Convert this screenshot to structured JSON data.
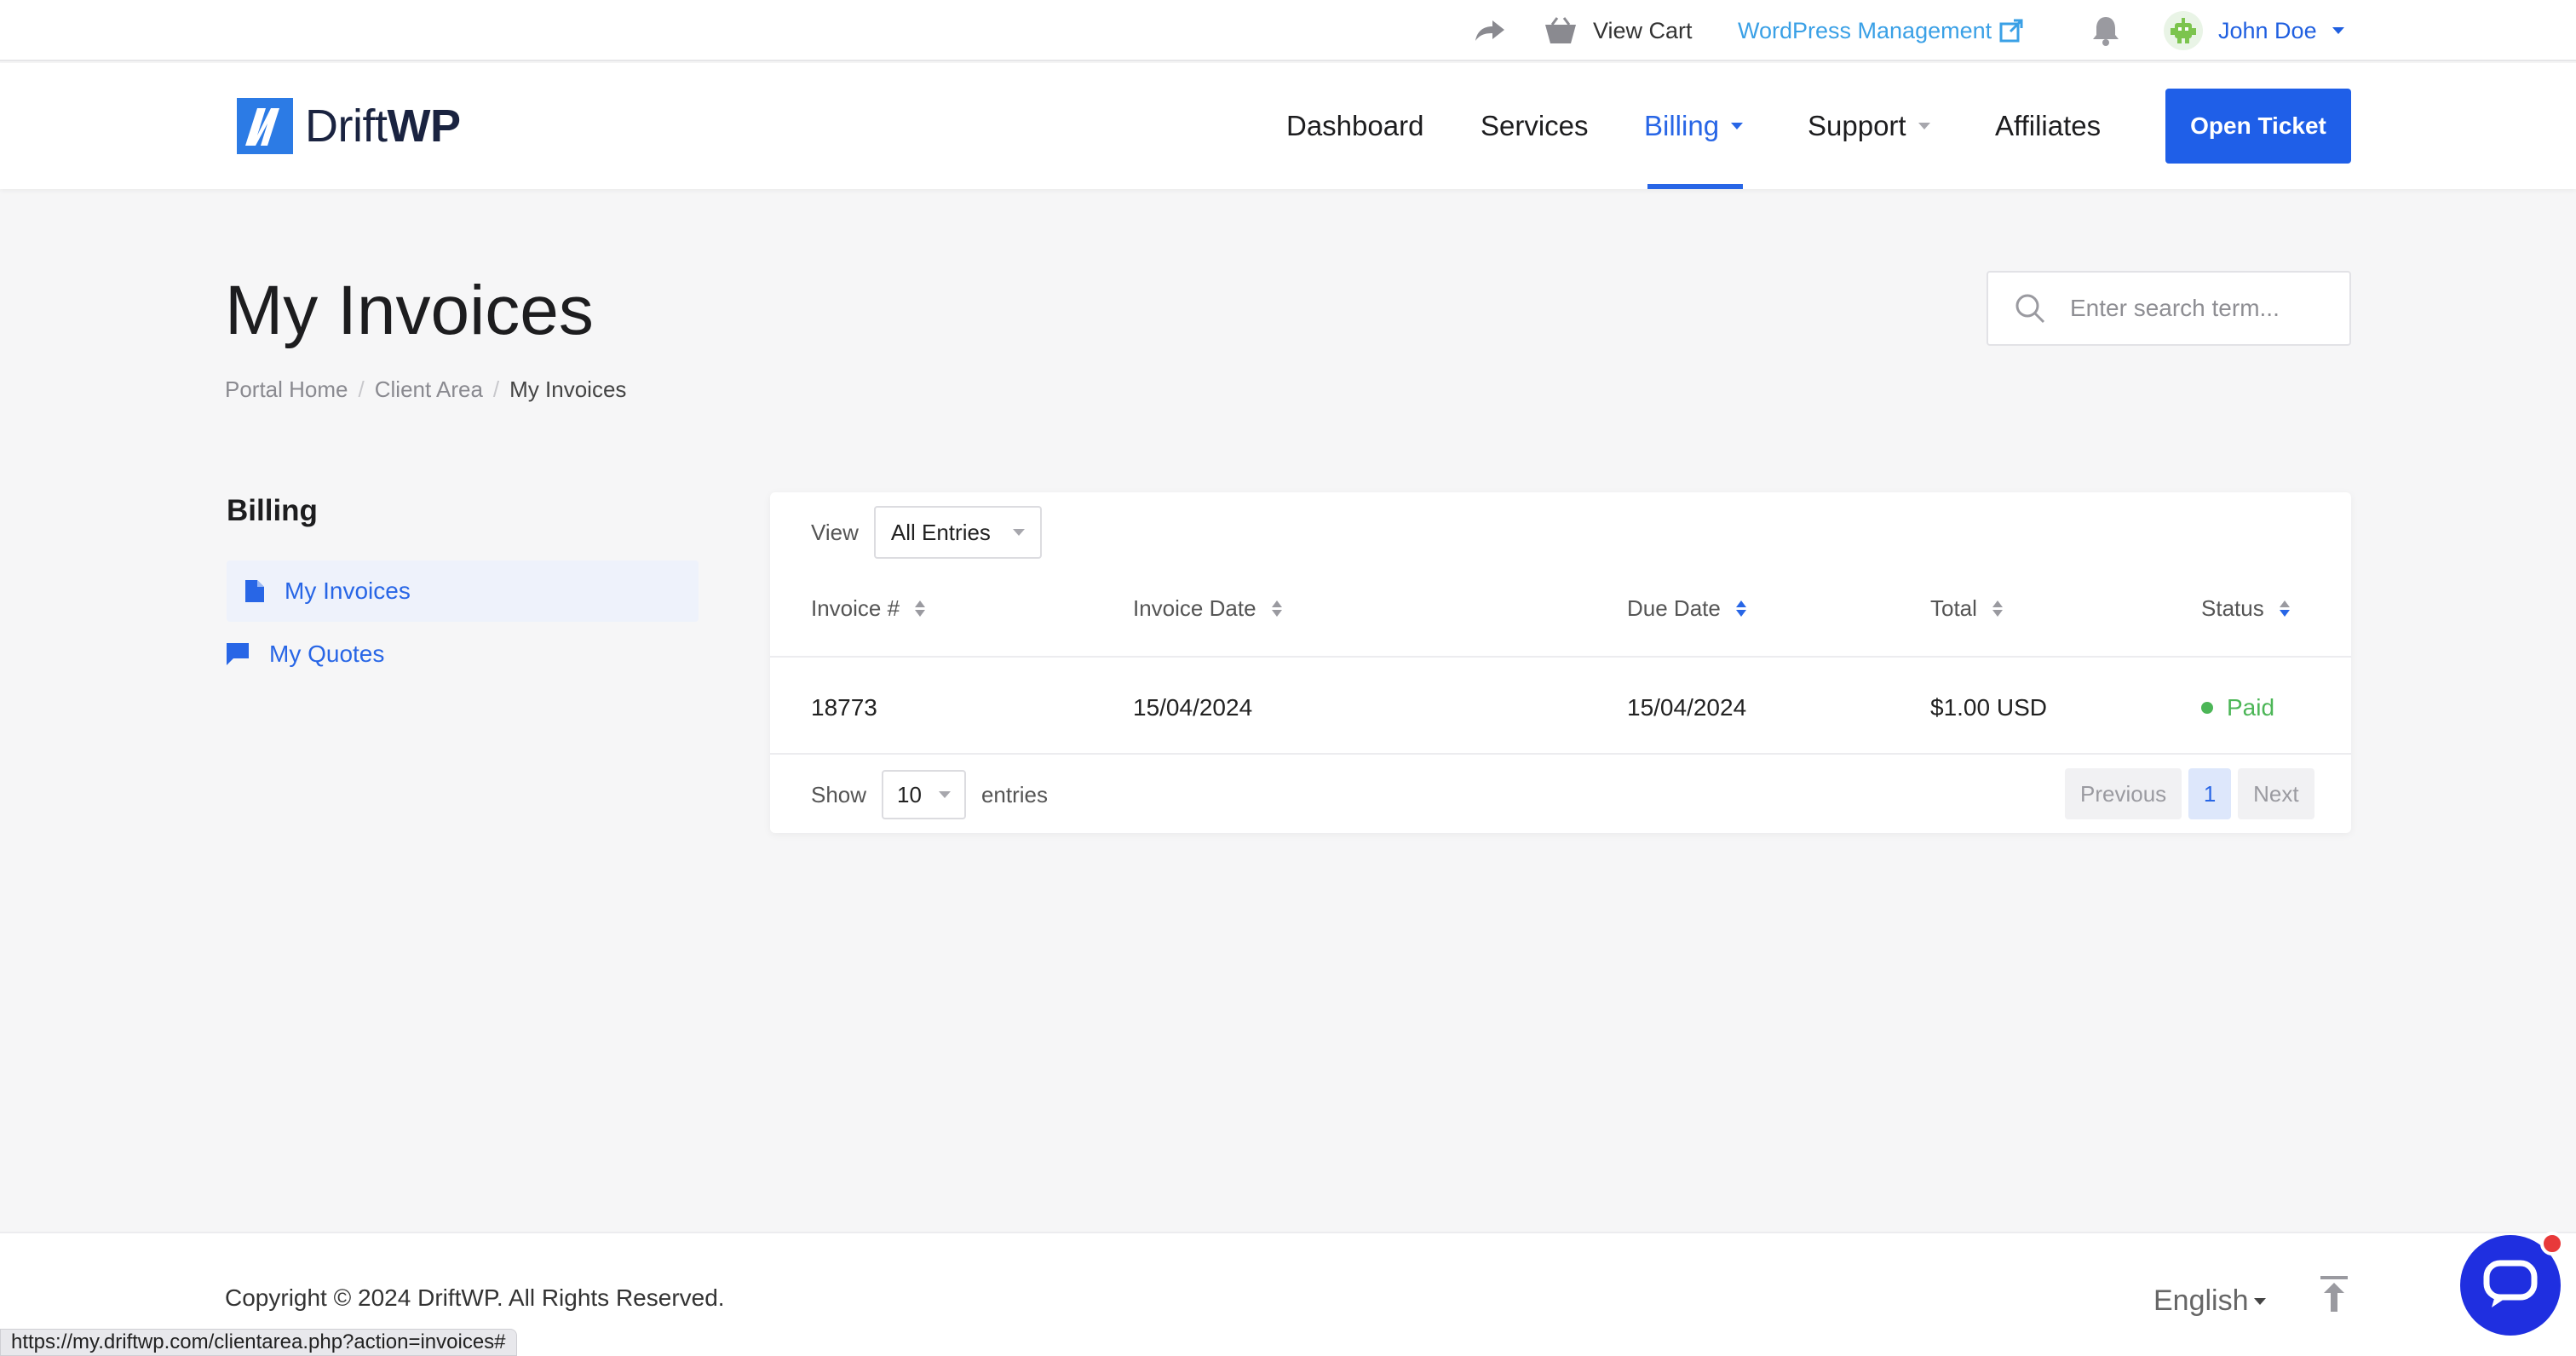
{
  "topbar": {
    "share_icon": "share-arrow-icon",
    "cart_label": "View Cart",
    "wp_management_label": "WordPress Management",
    "user_name": "John Doe"
  },
  "brand": {
    "logo_light": "Drift",
    "logo_bold": "WP",
    "accent": "#2866e6"
  },
  "nav": {
    "items": [
      {
        "label": "Dashboard"
      },
      {
        "label": "Services"
      },
      {
        "label": "Billing"
      },
      {
        "label": "Support"
      },
      {
        "label": "Affiliates"
      }
    ],
    "cta": "Open Ticket"
  },
  "page": {
    "title": "My Invoices",
    "breadcrumb": [
      "Portal Home",
      "Client Area",
      "My Invoices"
    ]
  },
  "search": {
    "placeholder": "Enter search term..."
  },
  "sidebar": {
    "heading": "Billing",
    "items": [
      {
        "label": "My Invoices"
      },
      {
        "label": "My Quotes"
      }
    ]
  },
  "table": {
    "view_label": "View",
    "view_value": "All Entries",
    "columns": [
      "Invoice #",
      "Invoice Date",
      "Due Date",
      "Total",
      "Status"
    ],
    "rows": [
      {
        "invoice": "18773",
        "invoice_date": "15/04/2024",
        "due_date": "15/04/2024",
        "total": "$1.00 USD",
        "status": "Paid"
      }
    ],
    "show_label": "Show",
    "show_value": "10",
    "entries_label": "entries",
    "pager": {
      "prev": "Previous",
      "page": "1",
      "next": "Next"
    }
  },
  "footer": {
    "copyright": "Copyright © 2024 DriftWP. All Rights Reserved.",
    "language": "English"
  },
  "statusbar": {
    "url": "https://my.driftwp.com/clientarea.php?action=invoices#"
  }
}
